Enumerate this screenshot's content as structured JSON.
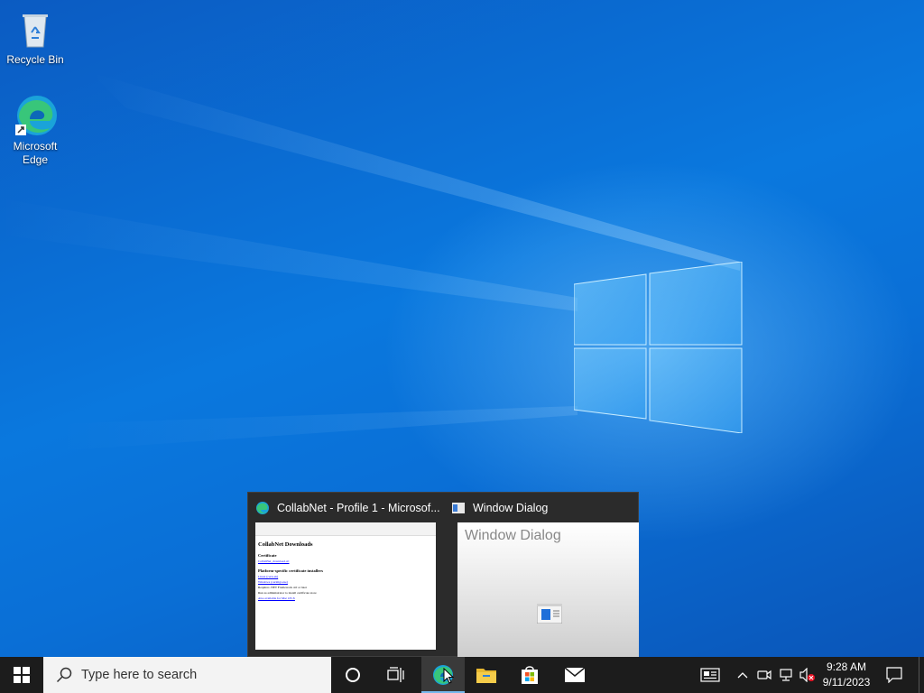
{
  "desktop": {
    "icons": [
      {
        "label": "Recycle Bin",
        "icon": "recycle-bin-icon"
      },
      {
        "label": "Microsoft Edge",
        "icon": "edge-icon"
      }
    ]
  },
  "flyout": {
    "thumbnails": [
      {
        "title": "CollabNet - Profile 1 - Microsof...",
        "icon": "edge-icon",
        "preview": {
          "heading": "CollabNet Downloads",
          "section1": "Certificate",
          "link1": "CollabNet_download.crt",
          "section2": "Platform-specific certificate installers",
          "items": [
            "Linux (certs.sh)",
            "Windows (certmgr.exe)",
            "Requires .NET Framework 4.0 or later",
            "Run as administrator to install certificate store",
            "Also available for Mac OS X"
          ]
        }
      },
      {
        "title": "Window Dialog",
        "icon": "window-dialog-icon",
        "preview": {
          "heading": "Window Dialog"
        }
      }
    ]
  },
  "taskbar": {
    "start_icon": "windows-start-icon",
    "search_placeholder": "Type here to search",
    "pinned": [
      "cortana-icon",
      "task-view-icon",
      "edge-icon",
      "file-explorer-icon",
      "microsoft-store-icon",
      "mail-icon"
    ],
    "tray_icons": [
      "news-icon",
      "chevron-up-icon",
      "meet-now-icon",
      "network-icon",
      "volume-muted-icon"
    ],
    "time": "9:28 AM",
    "date": "9/11/2023",
    "notification_icon": "action-center-icon"
  },
  "colors": {
    "taskbar": "#1c1c1c",
    "accent": "#76b9ed",
    "desktop": "#0a78de"
  }
}
